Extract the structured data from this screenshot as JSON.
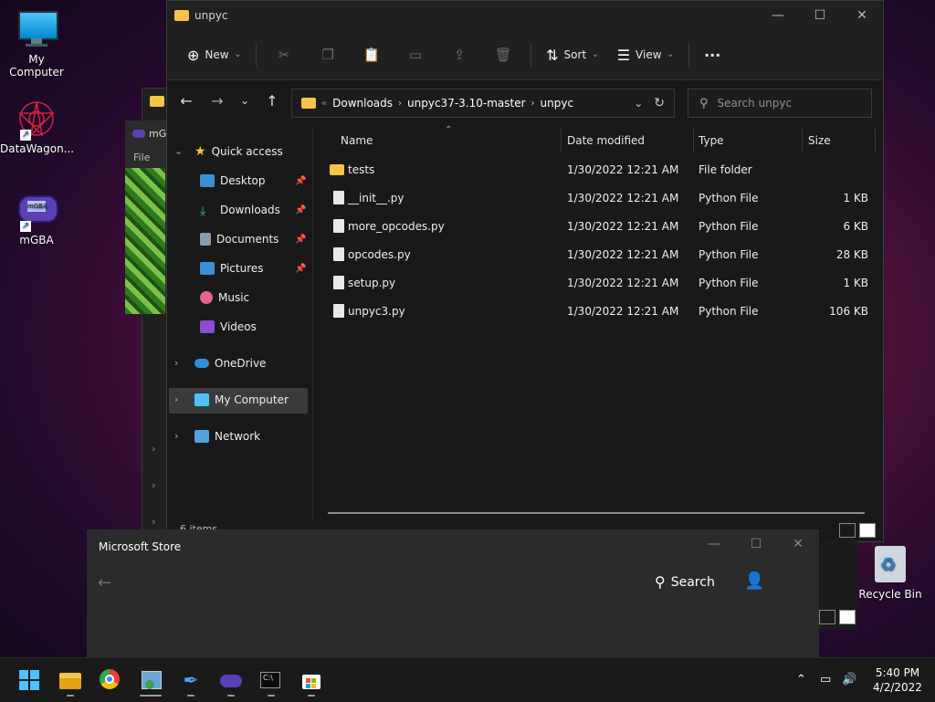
{
  "desktop": {
    "icons": [
      {
        "label": "My Computer",
        "icon": "monitor-icon"
      },
      {
        "label": "DataWagon...",
        "icon": "datawagon-icon"
      },
      {
        "label": "mGBA",
        "icon": "gameboy-icon"
      }
    ],
    "recycle_bin": "Recycle Bin"
  },
  "background_window": {
    "title": "mG",
    "menu": "File"
  },
  "explorer": {
    "title": "unpyc",
    "toolbar": {
      "new": "New",
      "sort": "Sort",
      "view": "View",
      "more": "···"
    },
    "address": {
      "crumbs": [
        "Downloads",
        "unpyc37-3.10-master",
        "unpyc"
      ]
    },
    "search_placeholder": "Search unpyc",
    "nav": [
      {
        "label": "Quick access",
        "icon": "star-icon"
      },
      {
        "label": "Desktop",
        "icon": "desktop-icon"
      },
      {
        "label": "Downloads",
        "icon": "download-icon"
      },
      {
        "label": "Documents",
        "icon": "documents-icon"
      },
      {
        "label": "Pictures",
        "icon": "pictures-icon"
      },
      {
        "label": "Music",
        "icon": "music-icon"
      },
      {
        "label": "Videos",
        "icon": "videos-icon"
      },
      {
        "label": "OneDrive",
        "icon": "cloud-icon"
      },
      {
        "label": "My Computer",
        "icon": "computer-icon"
      },
      {
        "label": "Network",
        "icon": "network-icon"
      }
    ],
    "columns": [
      "Name",
      "Date modified",
      "Type",
      "Size"
    ],
    "files": [
      {
        "name": "tests",
        "date": "1/30/2022 12:21 AM",
        "type": "File folder",
        "size": "",
        "kind": "folder"
      },
      {
        "name": "__init__.py",
        "date": "1/30/2022 12:21 AM",
        "type": "Python File",
        "size": "1 KB",
        "kind": "file"
      },
      {
        "name": "more_opcodes.py",
        "date": "1/30/2022 12:21 AM",
        "type": "Python File",
        "size": "6 KB",
        "kind": "file"
      },
      {
        "name": "opcodes.py",
        "date": "1/30/2022 12:21 AM",
        "type": "Python File",
        "size": "28 KB",
        "kind": "file"
      },
      {
        "name": "setup.py",
        "date": "1/30/2022 12:21 AM",
        "type": "Python File",
        "size": "1 KB",
        "kind": "file"
      },
      {
        "name": "unpyc3.py",
        "date": "1/30/2022 12:21 AM",
        "type": "Python File",
        "size": "106 KB",
        "kind": "file"
      }
    ],
    "status": "6 items"
  },
  "store": {
    "title": "Microsoft Store",
    "search": "Search"
  },
  "taskbar": {
    "apps": [
      "start-icon",
      "file-explorer-icon",
      "chrome-icon",
      "control-panel-icon",
      "pen-icon",
      "mgba-icon",
      "terminal-icon",
      "store-icon"
    ],
    "time": "5:40 PM",
    "date": "4/2/2022"
  }
}
